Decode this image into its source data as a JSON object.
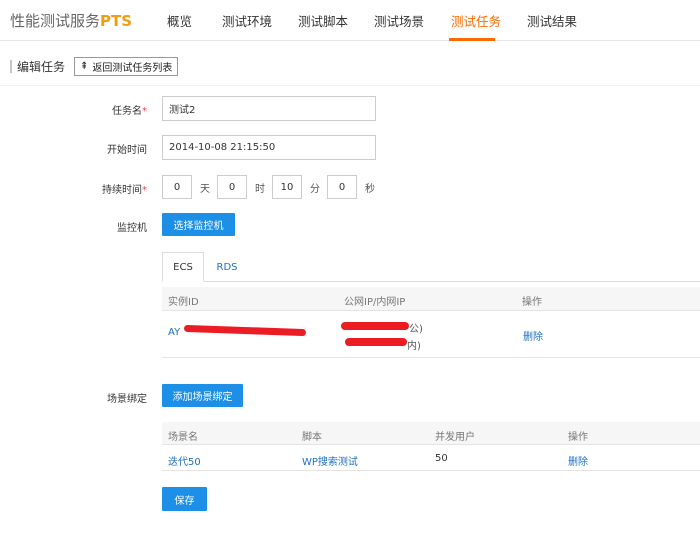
{
  "header": {
    "brand": "性能测试服务",
    "brand_accent": "PTS",
    "nav": [
      {
        "label": "概览",
        "active": false
      },
      {
        "label": "测试环境",
        "active": false
      },
      {
        "label": "测试脚本",
        "active": false
      },
      {
        "label": "测试场景",
        "active": false
      },
      {
        "label": "测试任务",
        "active": true
      },
      {
        "label": "测试结果",
        "active": false
      }
    ],
    "accent_color": "#ff6a00"
  },
  "page": {
    "title": "编辑任务",
    "back_arrow": "⇞",
    "back_label": "返回测试任务列表"
  },
  "form": {
    "task_name_label": "任务名",
    "task_name_value": "测试2",
    "start_time_label": "开始时间",
    "start_time_value": "2014-10-08 21:15:50",
    "duration_label": "持续时间",
    "required_mark": "*",
    "duration": {
      "days": "0",
      "days_unit": "天",
      "hours": "0",
      "hours_unit": "时",
      "minutes": "10",
      "minutes_unit": "分",
      "seconds": "0",
      "seconds_unit": "秒"
    },
    "monitor_label": "监控机",
    "monitor_button": "选择监控机",
    "scene_label": "场景绑定",
    "scene_button": "添加场景绑定",
    "save_button": "保存"
  },
  "monitor": {
    "tabs": [
      {
        "label": "ECS",
        "active": true
      },
      {
        "label": "RDS",
        "active": false
      }
    ],
    "columns": [
      "实例ID",
      "公网IP/内网IP",
      "操作"
    ],
    "rows": [
      {
        "id_prefix": "AY",
        "public_suffix": "公)",
        "private_suffix": "内)",
        "action": "删除"
      }
    ]
  },
  "scenes": {
    "columns": [
      "场景名",
      "脚本",
      "并发用户",
      "操作"
    ],
    "rows": [
      {
        "name": "迭代50",
        "script": "WP搜索测试",
        "users": "50",
        "action": "删除"
      }
    ]
  },
  "colors": {
    "primary_button": "#1e8fe6",
    "link": "#1e6fc5",
    "redaction": "#ec1c24"
  }
}
